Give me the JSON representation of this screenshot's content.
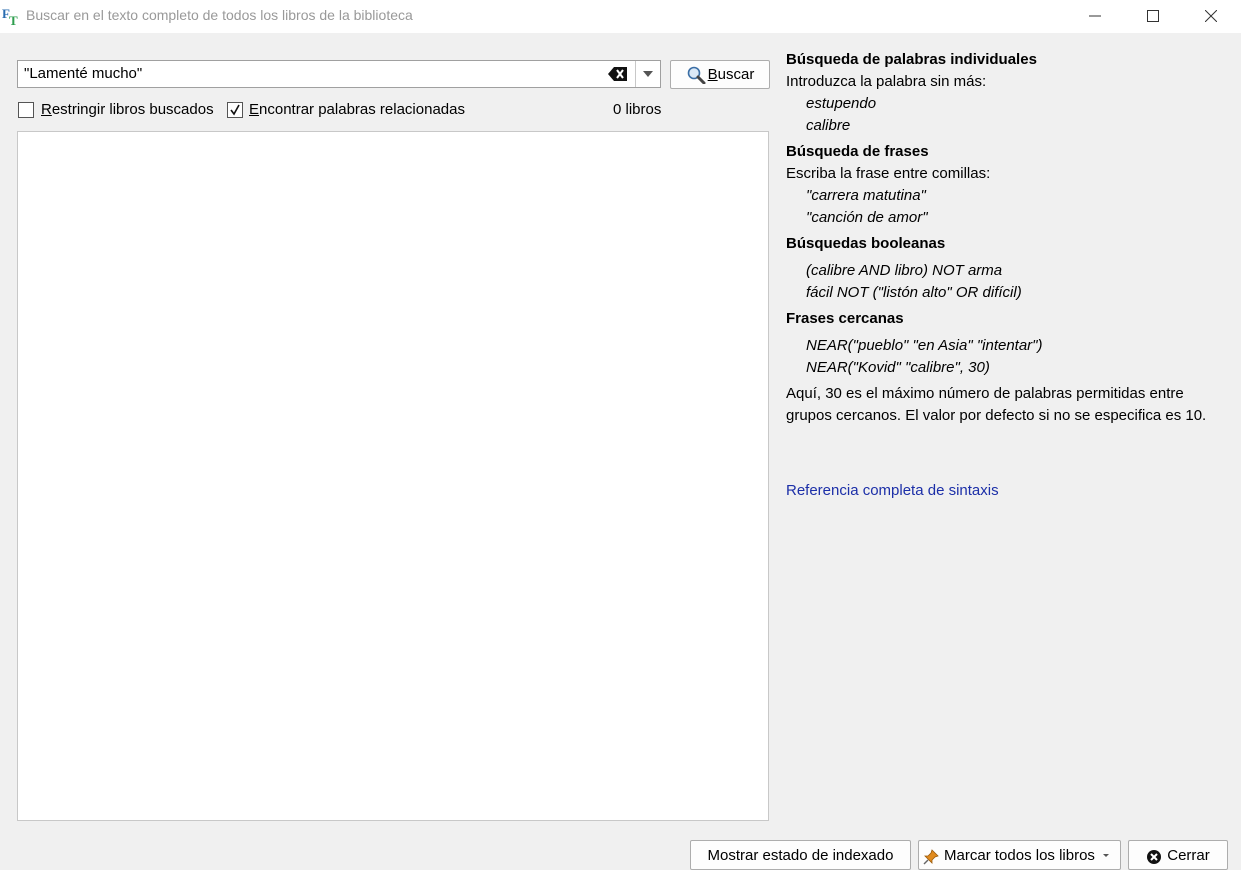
{
  "window": {
    "title": "Buscar en el texto completo de todos los libros de la biblioteca",
    "app_icon": "ft-icon"
  },
  "search": {
    "value": "\"Lamenté mucho\"",
    "button_label": "Buscar"
  },
  "options": {
    "restrict_label": "Restringir libros buscados",
    "restrict_checked": false,
    "related_label": "Encontrar palabras relacionadas",
    "related_checked": true,
    "books_count": "0 libros"
  },
  "help": {
    "sections": [
      {
        "heading": "Búsqueda de palabras individuales",
        "text": "Introduzca la palabra sin más:",
        "examples": [
          "estupendo",
          "calibre"
        ]
      },
      {
        "heading": "Búsqueda de frases",
        "text": "Escriba la frase entre comillas:",
        "examples": [
          "\"carrera matutina\"",
          "\"canción de amor\""
        ]
      },
      {
        "heading": "Búsquedas booleanas",
        "examples": [
          "(calibre AND libro) NOT arma",
          "fácil NOT (\"listón alto\" OR difícil)"
        ]
      },
      {
        "heading": "Frases cercanas",
        "examples": [
          "NEAR(\"pueblo\" \"en Asia\" \"intentar\")",
          "NEAR(\"Kovid\" \"calibre\", 30)"
        ],
        "note": "Aquí, 30 es el máximo número de palabras permitidas entre grupos cercanos. El valor por defecto si no se especifica es 10."
      }
    ],
    "link": "Referencia completa de sintaxis"
  },
  "footer": {
    "index_button": "Mostrar estado de indexado",
    "mark_button": "Marcar todos los libros",
    "close_button": "Cerrar"
  },
  "colors": {
    "link": "#1c2fa8",
    "title_text": "#999999",
    "background": "#f0f0f0"
  }
}
